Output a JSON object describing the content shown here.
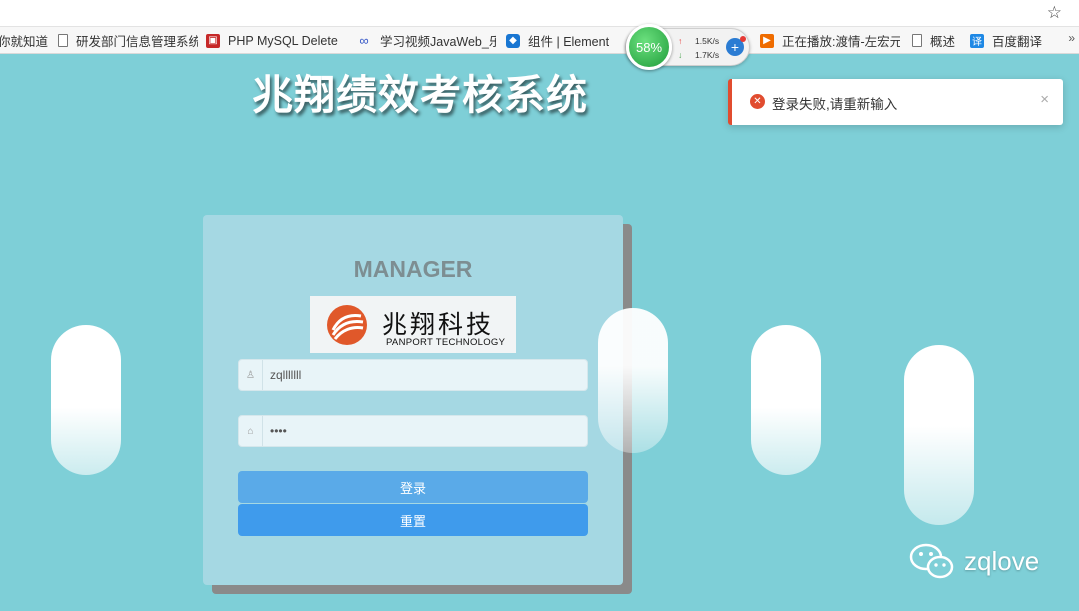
{
  "browser": {
    "bookmarks": [
      {
        "label": "你就知道",
        "icon": "none"
      },
      {
        "label": "研发部门信息管理系统",
        "icon": "page-icon"
      },
      {
        "label": "PHP MySQL Delete",
        "icon": "php-icon"
      },
      {
        "label": "学习视频JavaWeb_乐",
        "icon": "link-icon"
      },
      {
        "label": "组件 | Element",
        "icon": "element-icon"
      },
      {
        "label": "正在播放:渡情-左宏元",
        "icon": "play-icon"
      },
      {
        "label": "概述",
        "icon": "page-icon"
      },
      {
        "label": "百度翻译",
        "icon": "translate-icon"
      }
    ],
    "more": "»"
  },
  "net_widget": {
    "percent": "58%",
    "upload": "1.5K/s",
    "download": "1.7K/s",
    "upload_arrow": "↑",
    "download_arrow": "↓",
    "plus": "+"
  },
  "page": {
    "title": "兆翔绩效考核系统"
  },
  "notification": {
    "icon": "✕",
    "text": "登录失败,请重新输入",
    "close": "×",
    "accent": "#e14c2f"
  },
  "login": {
    "heading": "MANAGER",
    "logo": {
      "cn": "兆翔科技",
      "en": "PANPORT TECHNOLOGY"
    },
    "username": "zqlllllll",
    "password": "••••",
    "login_button": "登录",
    "reset_button": "重置"
  },
  "watermark": {
    "text": "zqlove"
  },
  "colors": {
    "background": "#7ecfd7",
    "card": "#a5d8e3",
    "login_button": "#5aaae8",
    "reset_button": "#3f9bec"
  }
}
